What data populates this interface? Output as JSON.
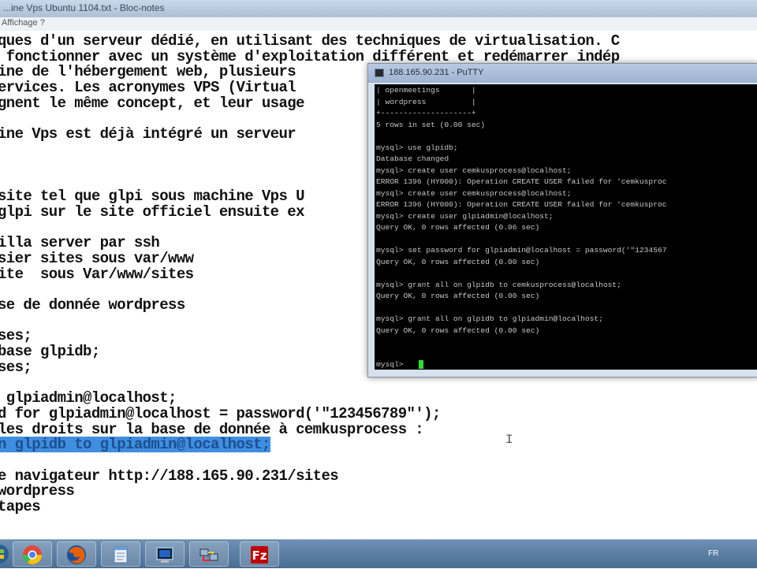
{
  "notepad": {
    "title": "...ine Vps Ubuntu 1104.txt - Bloc-notes",
    "menu": "Affichage   ?",
    "lines": [
      "ques d'un serveur dédié, en utilisant des techniques de virtualisation. C",
      " fonctionner avec un système d'exploitation différent et redémarrer indép",
      "ine de l'hébergement web, plusieurs",
      "ervices. Les acronymes VPS (Virtual",
      "gnent le même concept, et leur usage",
      "",
      "ine Vps est déjà intégré un serveur",
      "",
      "",
      "",
      "site tel que glpi sous machine Vps U",
      "glpi sur le site officiel ensuite ex",
      "",
      "illa server par ssh",
      "sier sites sous var/www",
      "ite  sous Var/www/sites",
      "",
      "se de donnée wordpress",
      "",
      "ses;",
      "base glpidb;",
      "ses;",
      "",
      " glpiadmin@localhost;",
      "d for glpiadmin@localhost = password('\"123456789\"');",
      "les droits sur la base de donnée à cemkusprocess :",
      "n glpidb to glpiadmin@localhost;",
      "",
      "e navigateur http://188.165.90.231/sites",
      "wordpress",
      "tapes"
    ],
    "selected_line_index": 26
  },
  "putty": {
    "title": "188.165.90.231 - PuTTY",
    "terminal_lines": [
      "| openmeetings       |",
      "| wordpress          |",
      "+--------------------+",
      "5 rows in set (0.00 sec)",
      "",
      "mysql> use glpidb;",
      "Database changed",
      "mysql> create user cemkusprocess@localhost;",
      "ERROR 1396 (HY000): Operation CREATE USER failed for 'cemkusproc",
      "mysql> create user cemkusprocess@localhost;",
      "ERROR 1396 (HY000): Operation CREATE USER failed for 'cemkusproc",
      "mysql> create user glpiadmin@localhost;",
      "Query OK, 0 rows affected (0.06 sec)",
      "",
      "mysql> set password for glpiadmin@localhost = password('\"1234567",
      "Query OK, 0 rows affected (0.00 sec)",
      "",
      "mysql> grant all on glpidb to cemkusprocess@localhost;",
      "Query OK, 0 rows affected (0.00 sec)",
      "",
      "mysql> grant all on glpidb to glpiadmin@localhost;",
      "Query OK, 0 rows affected (0.00 sec)",
      "",
      "",
      "mysql> "
    ]
  },
  "taskbar": {
    "apps": [
      {
        "name": "start",
        "icon": "windows-orb-icon"
      },
      {
        "name": "chrome",
        "icon": "chrome-icon"
      },
      {
        "name": "firefox",
        "icon": "firefox-icon"
      },
      {
        "name": "notepad",
        "icon": "notepad-icon"
      },
      {
        "name": "putty",
        "icon": "putty-icon"
      },
      {
        "name": "network",
        "icon": "network-icon"
      },
      {
        "name": "filezilla",
        "icon": "filezilla-icon"
      }
    ],
    "language": "FR",
    "colors": {
      "taskbar": "#4a6d93",
      "selection": "#3f8ee0",
      "cursor": "#2fe02f"
    }
  }
}
